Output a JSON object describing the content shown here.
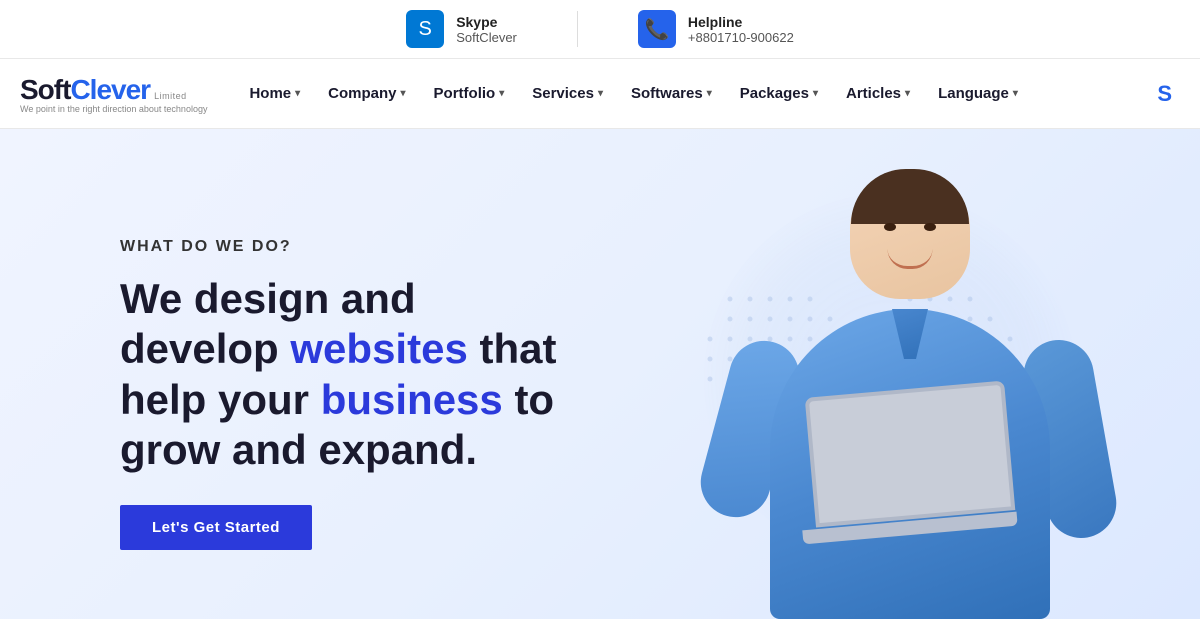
{
  "topbar": {
    "skype_label": "Skype",
    "skype_value": "SoftClever",
    "helpline_label": "Helpline",
    "helpline_value": "+8801710-900622",
    "skype_icon": "S",
    "helpline_icon": "📞"
  },
  "navbar": {
    "logo_soft": "Soft",
    "logo_clever": "Clever",
    "logo_limited": "Limited",
    "logo_tagline": "We point in the right direction about technology",
    "nav_items": [
      {
        "label": "Home",
        "has_dropdown": true
      },
      {
        "label": "Company",
        "has_dropdown": true
      },
      {
        "label": "Portfolio",
        "has_dropdown": true
      },
      {
        "label": "Services",
        "has_dropdown": true
      },
      {
        "label": "Softwares",
        "has_dropdown": true
      },
      {
        "label": "Packages",
        "has_dropdown": true
      },
      {
        "label": "Articles",
        "has_dropdown": true
      },
      {
        "label": "Language",
        "has_dropdown": true
      }
    ],
    "nav_right_label": "S"
  },
  "hero": {
    "subtitle": "WHAT DO WE DO?",
    "title_part1": "We design and develop ",
    "title_highlight1": "websites",
    "title_part2": " that help your ",
    "title_highlight2": "business",
    "title_part3": " to grow and expand.",
    "cta_label": "Let's Get Started"
  }
}
